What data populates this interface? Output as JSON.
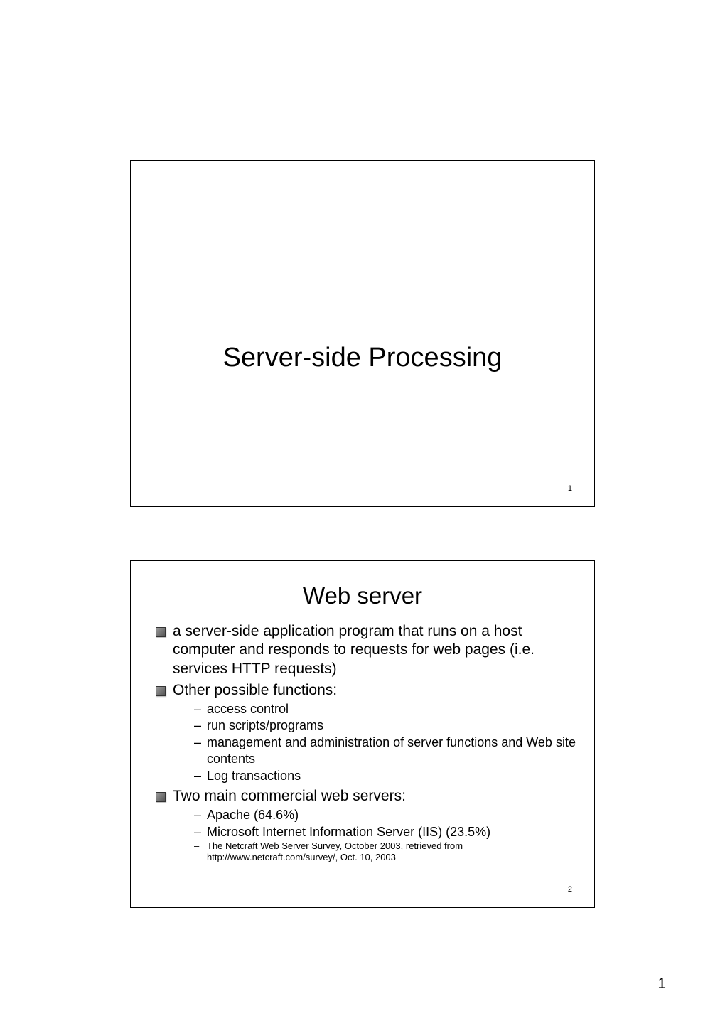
{
  "page_number": "1",
  "slide1": {
    "title": "Server-side Processing",
    "number": "1"
  },
  "slide2": {
    "title": "Web server",
    "number": "2",
    "bullets": [
      {
        "text": "a server-side application program that runs on a host computer and responds to requests for web pages (i.e. services HTTP requests)",
        "subs": []
      },
      {
        "text": "Other possible functions:",
        "subs": [
          {
            "text": "access control",
            "small": false
          },
          {
            "text": "run scripts/programs",
            "small": false
          },
          {
            "text": "management and administration of server functions and Web site contents",
            "small": false
          },
          {
            "text": "Log transactions",
            "small": false
          }
        ]
      },
      {
        "text": "Two main commercial web servers:",
        "subs": [
          {
            "text": "Apache (64.6%)",
            "small": false
          },
          {
            "text": "Microsoft Internet Information Server (IIS) (23.5%)",
            "small": false
          },
          {
            "text": "The Netcraft Web Server Survey, October 2003, retrieved from http://www.netcraft.com/survey/, Oct. 10, 2003",
            "small": true
          }
        ]
      }
    ]
  }
}
